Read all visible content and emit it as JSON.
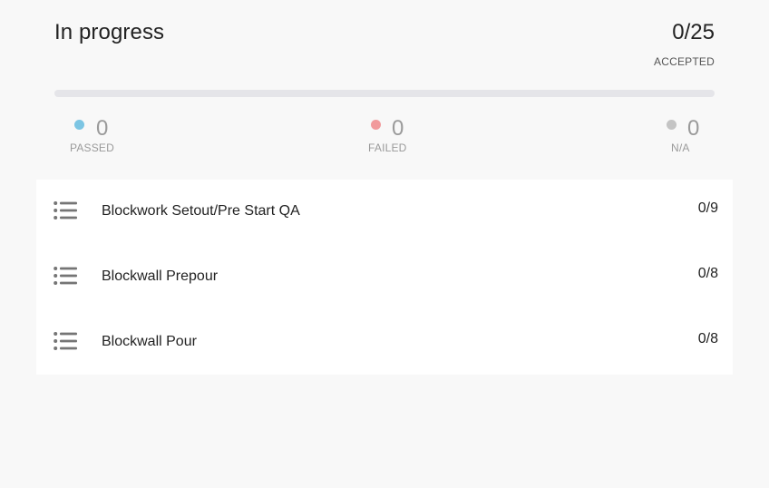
{
  "header": {
    "title": "In progress",
    "accepted_count": "0/25",
    "accepted_label": "ACCEPTED"
  },
  "progress": {
    "accepted": 0,
    "total": 25,
    "fill_fraction": 0
  },
  "stats": {
    "passed": {
      "value": "0",
      "label": "PASSED",
      "color": "#7cc5e3"
    },
    "failed": {
      "value": "0",
      "label": "FAILED",
      "color": "#f19a9c"
    },
    "na": {
      "value": "0",
      "label": "N/A",
      "color": "#c4c4c4"
    }
  },
  "checklists": [
    {
      "title": "Blockwork Setout/Pre Start QA",
      "count": "0/9",
      "icon": "list-icon"
    },
    {
      "title": "Blockwall Prepour",
      "count": "0/8",
      "icon": "list-icon"
    },
    {
      "title": "Blockwall Pour",
      "count": "0/8",
      "icon": "list-icon"
    }
  ],
  "colors": {
    "background": "#f8f8f8",
    "panel": "#ffffff",
    "track": "#e5e5e9",
    "icon": "#757575"
  }
}
